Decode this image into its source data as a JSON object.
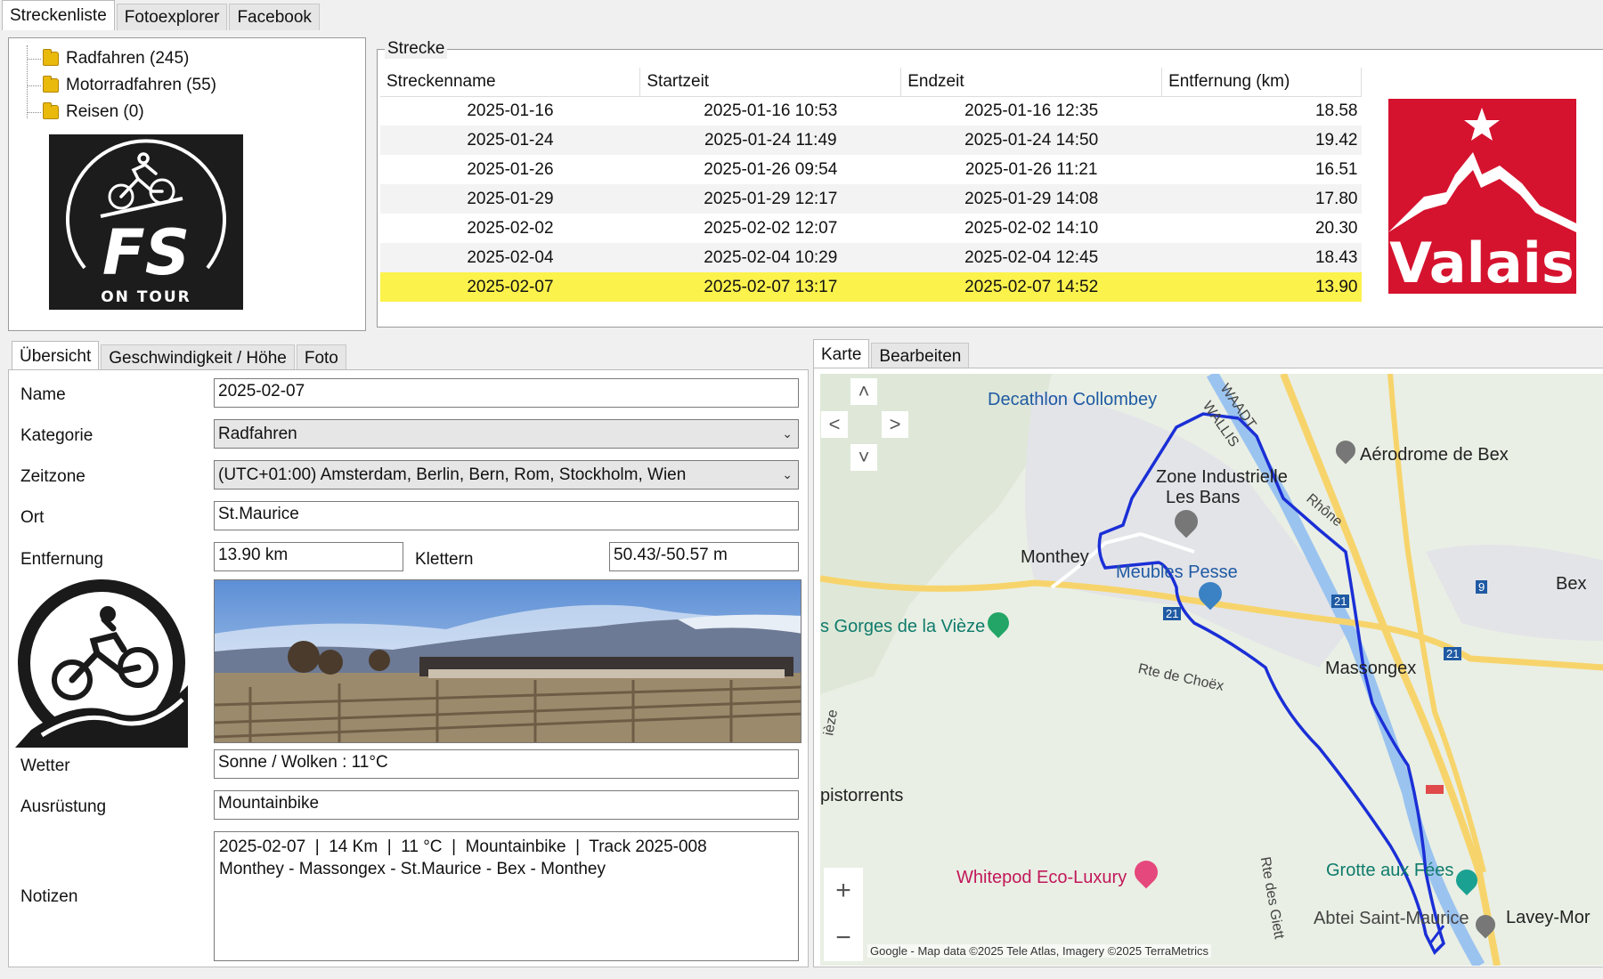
{
  "top_tabs": [
    "Streckenliste",
    "Fotoexplorer",
    "Facebook"
  ],
  "tree": [
    {
      "label": "Radfahren (245)"
    },
    {
      "label": "Motorradfahren (55)"
    },
    {
      "label": "Reisen (0)"
    }
  ],
  "logo_fs": {
    "letters": "FS",
    "subtitle": "ON TOUR"
  },
  "strecke": {
    "group_label": "Strecke",
    "columns": [
      "Streckenname",
      "Startzeit",
      "Endzeit",
      "Entfernung (km)"
    ],
    "rows": [
      [
        "2025-01-16",
        "2025-01-16 10:53",
        "2025-01-16 12:35",
        "18.58"
      ],
      [
        "2025-01-24",
        "2025-01-24 11:49",
        "2025-01-24 14:50",
        "19.42"
      ],
      [
        "2025-01-26",
        "2025-01-26 09:54",
        "2025-01-26 11:21",
        "16.51"
      ],
      [
        "2025-01-29",
        "2025-01-29 12:17",
        "2025-01-29 14:08",
        "17.80"
      ],
      [
        "2025-02-02",
        "2025-02-02 12:07",
        "2025-02-02 14:10",
        "20.30"
      ],
      [
        "2025-02-04",
        "2025-02-04 10:29",
        "2025-02-04 12:45",
        "18.43"
      ],
      [
        "2025-02-07",
        "2025-02-07 13:17",
        "2025-02-07 14:52",
        "13.90"
      ]
    ],
    "selected_index": 6
  },
  "valais_logo": {
    "text": "Valais"
  },
  "detail_tabs": [
    "Übersicht",
    "Geschwindigkeit / Höhe",
    "Foto"
  ],
  "form": {
    "name_label": "Name",
    "name_value": "2025-02-07",
    "kategorie_label": "Kategorie",
    "kategorie_value": "Radfahren",
    "zeitzone_label": "Zeitzone",
    "zeitzone_value": "(UTC+01:00) Amsterdam, Berlin, Bern, Rom, Stockholm, Wien",
    "ort_label": "Ort",
    "ort_value": "St.Maurice",
    "entfernung_label": "Entfernung",
    "entfernung_value": "13.90 km",
    "klettern_label": "Klettern",
    "klettern_value": "50.43/-50.57 m",
    "wetter_label": "Wetter",
    "wetter_value": "Sonne / Wolken  :  11°C",
    "ausruestung_label": "Ausrüstung",
    "ausruestung_value": "Mountainbike",
    "notizen_label": "Notizen",
    "notizen_value": "2025-02-07  |  14 Km  |  11 °C  |  Mountainbike  |  Track 2025-008\nMonthey - Massongex - St.Maurice - Bex - Monthey"
  },
  "map_tabs": [
    "Karte",
    "Bearbeiten"
  ],
  "map": {
    "labels": {
      "decathlon": "Decathlon Collombey",
      "waadt": "WAADT",
      "wallis": "WALLIS",
      "aerodrome": "Aérodrome de Bex",
      "zone": "Zone Industrielle",
      "lesbans": "Les Bans",
      "rhone": "Rhône",
      "monthey": "Monthey",
      "meubles": "Meubles Pesse",
      "bex": "Bex",
      "gorges": "s Gorges de la Vièze",
      "massongex": "Massongex",
      "rtechoex": "Rte de Choëx",
      "pistorrents": "pistorrents",
      "whitepod": "Whitepod Eco-Luxury",
      "grotte": "Grotte aux Fées",
      "abtei": "Abtei Saint-Maurice",
      "lavey": "Lavey-Mor",
      "rtegiett": "Rte des Giett",
      "vieze": "ièze",
      "road21a": "21",
      "road21b": "21",
      "road21c": "21",
      "road9": "9"
    },
    "attribution": "Google - Map data ©2025 Tele Atlas, Imagery ©2025 TerraMetrics",
    "zoom_in": "+",
    "zoom_out": "−",
    "colors": {
      "track": "#1b2fd6",
      "motorway": "#f7d46b",
      "river": "#9bc3f0",
      "urban": "#e3e4e8"
    }
  }
}
